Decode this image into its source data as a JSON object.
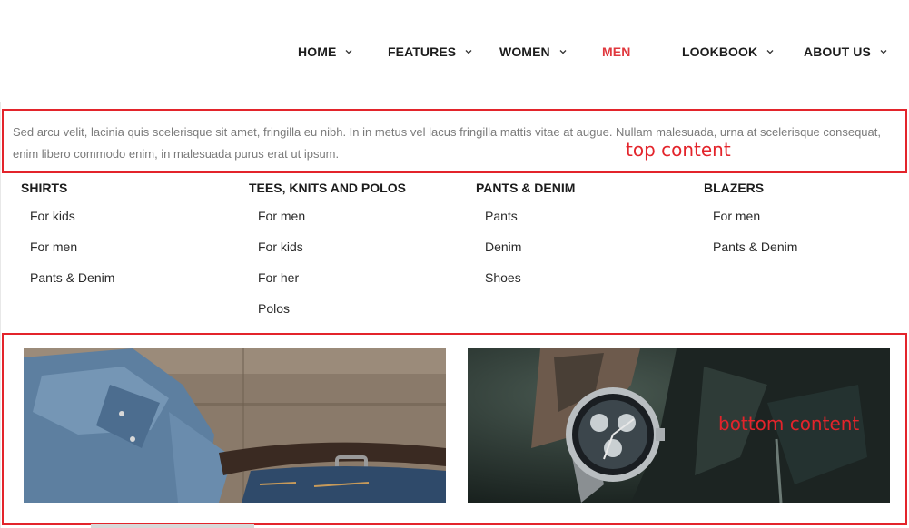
{
  "nav": {
    "items": [
      {
        "label": "HOME",
        "has_dropdown": true,
        "active": false
      },
      {
        "label": "FEATURES",
        "has_dropdown": true,
        "active": false
      },
      {
        "label": "WOMEN",
        "has_dropdown": true,
        "active": false
      },
      {
        "label": "MEN",
        "has_dropdown": false,
        "active": true
      },
      {
        "label": "LOOKBOOK",
        "has_dropdown": true,
        "active": false
      },
      {
        "label": "ABOUT US",
        "has_dropdown": true,
        "active": false
      }
    ],
    "active_color": "#e0383e"
  },
  "mega_menu": {
    "top_content": {
      "text": "Sed arcu velit, lacinia quis scelerisque sit amet, fringilla eu nibh. In in metus vel lacus fringilla mattis vitae at augue. Nullam malesuada, urna at scelerisque consequat, enim libero commodo enim, in malesuada purus erat ut ipsum.",
      "annotation": "top content"
    },
    "columns": [
      {
        "title": "SHIRTS",
        "links": [
          "For kids",
          "For men",
          "Pants & Denim"
        ]
      },
      {
        "title": "TEES, KNITS AND POLOS",
        "links": [
          "For men",
          "For kids",
          "For her",
          "Polos"
        ]
      },
      {
        "title": "PANTS & DENIM",
        "links": [
          "Pants",
          "Denim",
          "Shoes"
        ]
      },
      {
        "title": "BLAZERS",
        "links": [
          "For men",
          "Pants & Denim"
        ]
      }
    ],
    "bottom_content": {
      "annotation": "bottom content",
      "images": [
        {
          "icon": "denim-shirt-belt-image"
        },
        {
          "icon": "wristwatch-image"
        }
      ]
    },
    "annotation_color": "#e3242b"
  }
}
